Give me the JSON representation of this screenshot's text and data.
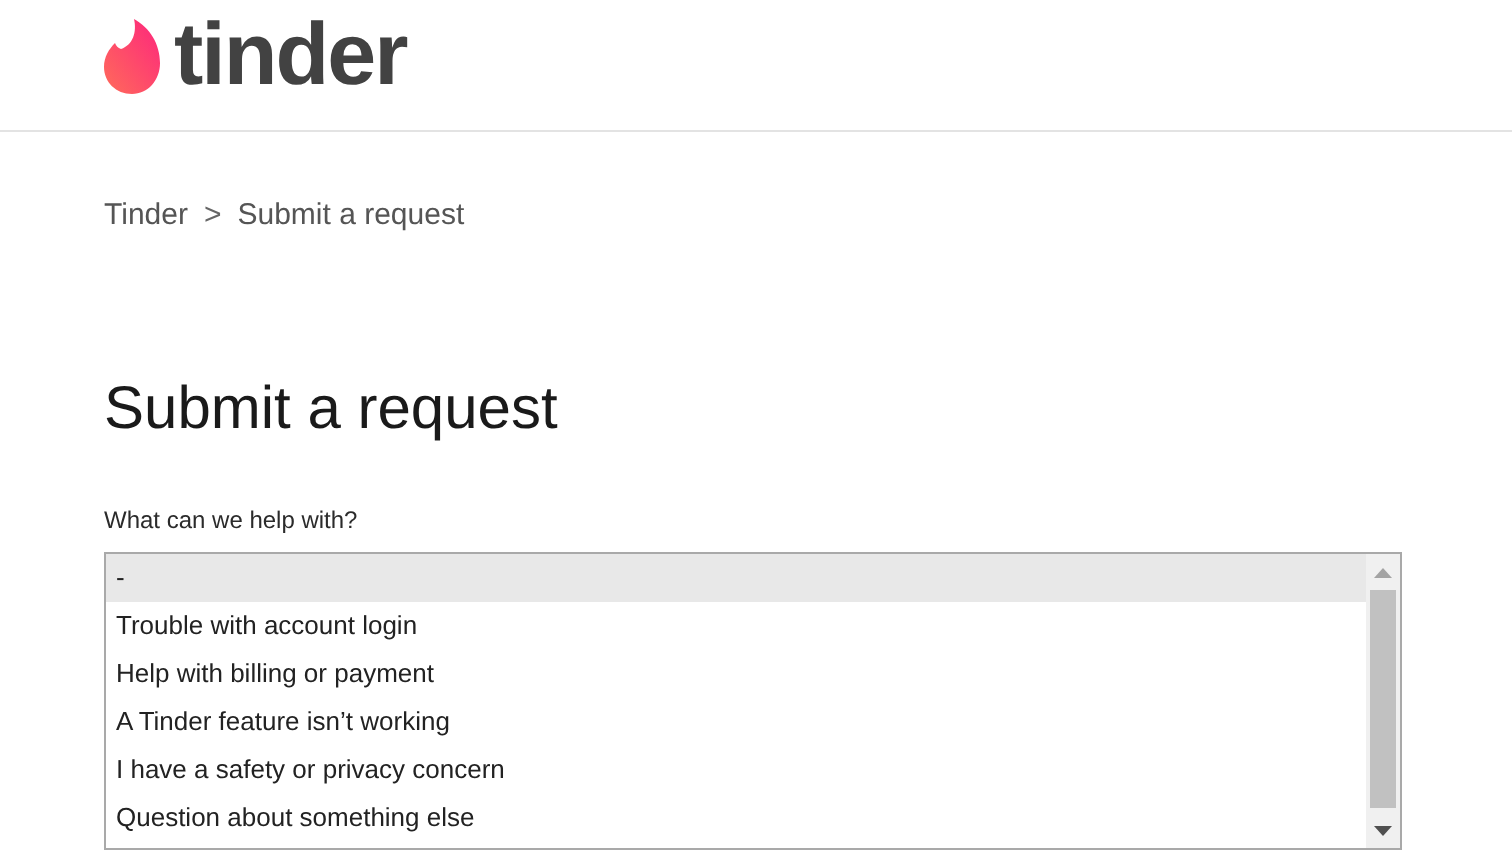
{
  "header": {
    "logo_text": "tinder"
  },
  "breadcrumbs": [
    {
      "label": "Tinder"
    },
    {
      "label": "Submit a request"
    }
  ],
  "breadcrumb_separator": ">",
  "title": "Submit a request",
  "field": {
    "label": "What can we help with?",
    "options": [
      {
        "label": "-",
        "selected": true
      },
      {
        "label": "Trouble with account login",
        "selected": false
      },
      {
        "label": "Help with billing or payment",
        "selected": false
      },
      {
        "label": "A Tinder feature isn’t working",
        "selected": false
      },
      {
        "label": "I have a safety or privacy concern",
        "selected": false
      },
      {
        "label": "Question about something else",
        "selected": false
      }
    ]
  }
}
